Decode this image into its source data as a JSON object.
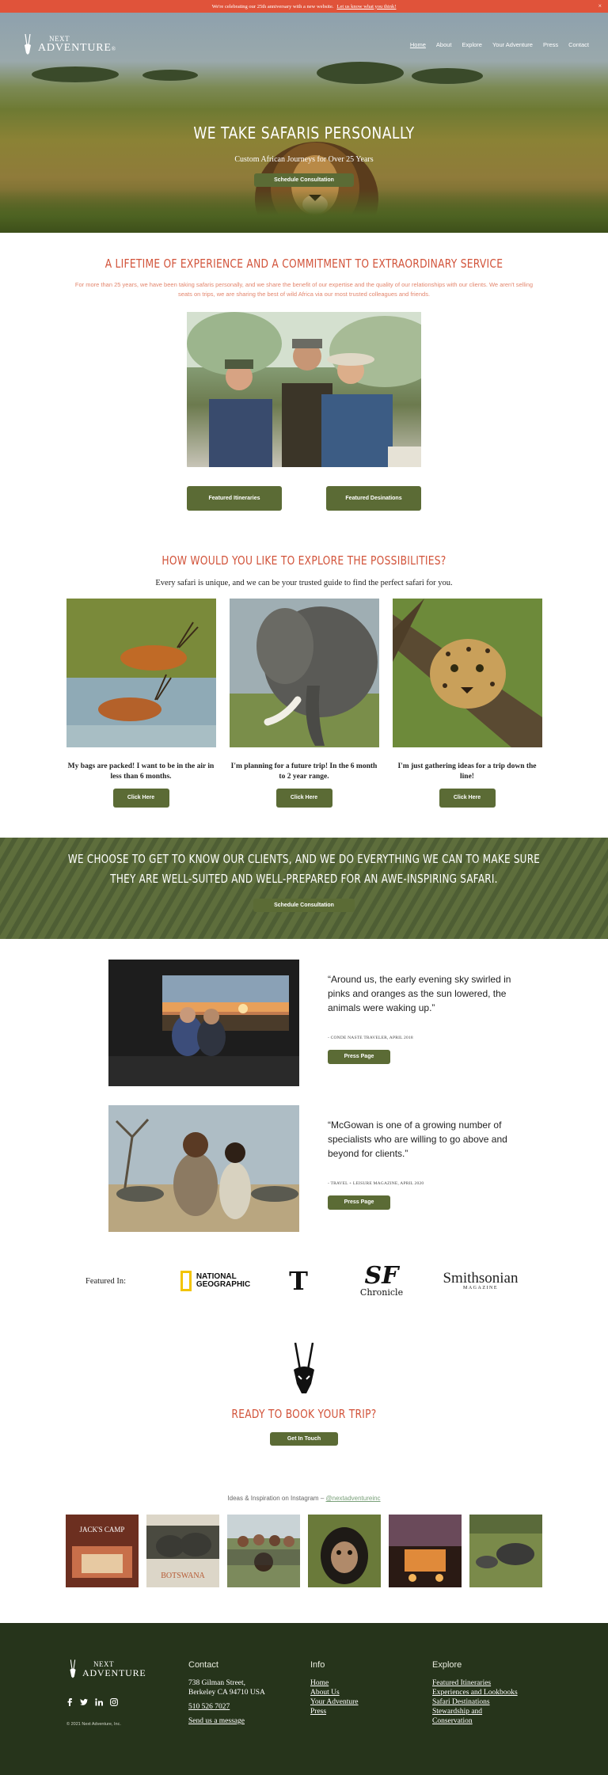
{
  "announcement": {
    "text": "We're celebrating our 25th anniversary with a new website.",
    "link": "Let us know what you think!",
    "close": "×"
  },
  "nav": {
    "logo_top": "NEXT",
    "logo_bottom": "ADVENTURE",
    "logo_mark": "®",
    "items": [
      {
        "label": "Home"
      },
      {
        "label": "About"
      },
      {
        "label": "Explore"
      },
      {
        "label": "Your Adventure"
      },
      {
        "label": "Press"
      },
      {
        "label": "Contact"
      }
    ]
  },
  "hero": {
    "title": "WE TAKE SAFARIS PERSONALLY",
    "subtitle": "Custom African Journeys for Over 25 Years",
    "button": "Schedule Consultation"
  },
  "lifetime": {
    "title": "A LIFETIME OF EXPERIENCE AND A COMMITMENT TO EXTRAORDINARY SERVICE",
    "body": "For more than 25 years, we have been taking safaris personally, and we share the benefit of our expertise and the quality of our relationships with our clients. We aren't selling seats on trips, we are sharing the best of wild Africa via our most trusted colleagues and friends.",
    "button_left": "Featured Itineraries",
    "button_right": "Featured Desinations"
  },
  "explore": {
    "title": "HOW WOULD YOU LIKE TO EXPLORE THE POSSIBILITIES?",
    "subtitle": "Every safari is unique, and we can be your trusted guide to find the perfect safari for you.",
    "cards": [
      {
        "caption": "My bags are packed! I want to be in the air in less than 6 months.",
        "button": "Click Here"
      },
      {
        "caption": "I'm planning for a future trip! In the  6 month to 2 year range.",
        "button": "Click Here"
      },
      {
        "caption": "I'm just gathering ideas for a trip down the line!",
        "button": "Click Here"
      }
    ]
  },
  "banner": {
    "title": "WE CHOOSE TO GET TO KNOW OUR CLIENTS, AND WE DO EVERYTHING WE CAN TO MAKE SURE THEY ARE WELL-SUITED AND WELL-PREPARED FOR AN AWE-INSPIRING SAFARI.",
    "button": "Schedule Consultation"
  },
  "press": [
    {
      "quote": "“Around us, the early evening sky swirled in pinks and oranges as the sun lowered, the animals were waking up.”",
      "source": "- CONDE NASTE TRAVELER, APRIL 2018",
      "button": "Press Page"
    },
    {
      "quote": "“McGowan is one of a growing number of specialists who are willing to go above and beyond for clients.”",
      "source": "- TRAVEL + LEISURE MAGAZINE, APRIL 2020",
      "button": "Press Page"
    }
  ],
  "featured": {
    "label": "Featured In:",
    "ng_line1": "NATIONAL",
    "ng_line2": "GEOGRAPHIC",
    "nyt": "T",
    "sf_line1": "SF",
    "sf_line2": "Chronicle",
    "smith_line1": "Smithsonian",
    "smith_line2": "MAGAZINE"
  },
  "ready": {
    "title": "READY TO BOOK YOUR TRIP?",
    "button": "Get In Touch"
  },
  "instagram": {
    "title": "Ideas & Inspiration on Instagram – ",
    "handle": "@nextadventureinc",
    "tile1_title": "JACK'S CAMP",
    "tile2_title": "BOTSWANA"
  },
  "footer": {
    "logo_top": "NEXT",
    "logo_bottom": "ADVENTURE",
    "copyright": "© 2021 Next Adventure, Inc.",
    "contact": {
      "heading": "Contact",
      "address1": "738 Gilman Street,",
      "address2": "Berkeley CA 94710 USA",
      "phone": "510 526 7027",
      "message": "Send us a message"
    },
    "info": {
      "heading": "Info",
      "links": [
        "Home",
        "About Us",
        "Your Adventure",
        "Press"
      ]
    },
    "explore": {
      "heading": "Explore",
      "links": [
        "Featured Itineraries",
        "Experiences and Lookbooks",
        "Safari Destinations",
        "Stewardship and",
        "Conservation"
      ]
    }
  },
  "colors": {
    "accent": "#d2533a",
    "announcement": "#e0533a",
    "button": "#5b6b35",
    "footer": "#26341b"
  }
}
